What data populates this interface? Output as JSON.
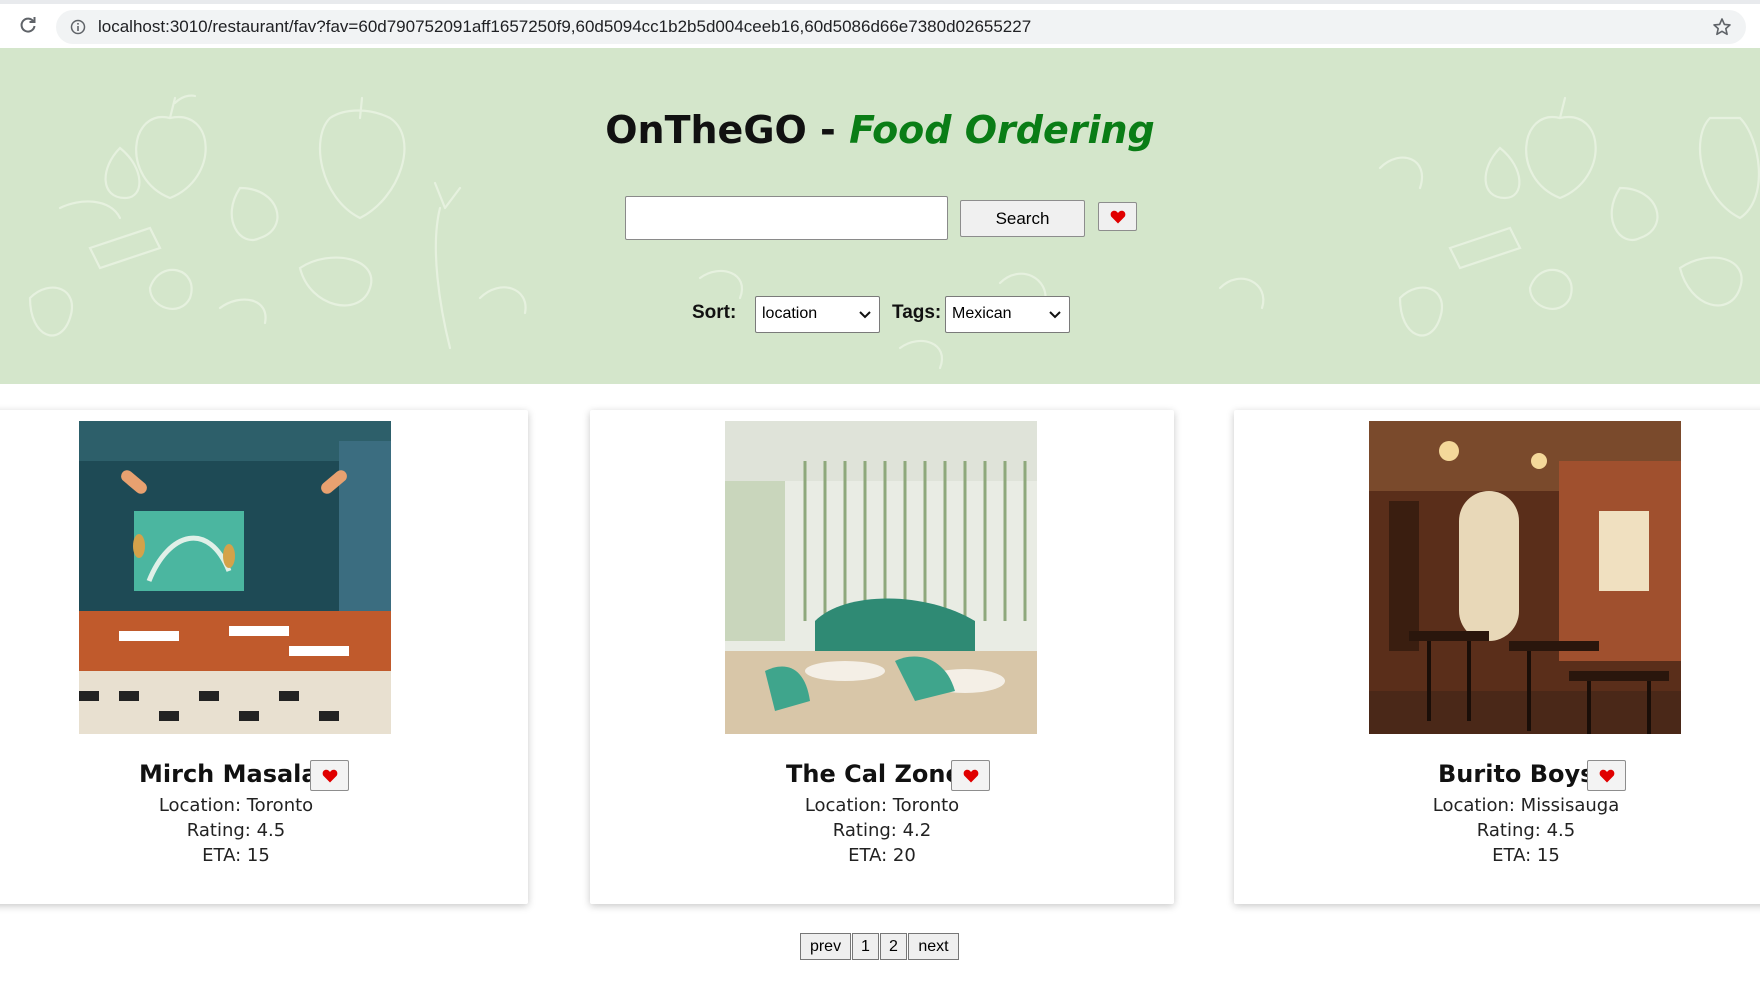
{
  "browser": {
    "url": "localhost:3010/restaurant/fav?fav=60d790752091aff1657250f9,60d5094cc1b2b5d004ceeb16,60d5086d66e7380d02655227"
  },
  "header": {
    "brand": "OnTheGO",
    "separator": " - ",
    "subtitle": "Food Ordering",
    "search_value": "",
    "search_button": "Search",
    "sort_label": "Sort:",
    "sort_value": "location",
    "tags_label": "Tags:",
    "tags_value": "Mexican"
  },
  "restaurants": [
    {
      "name": "Mirch Masala",
      "location": "Location: Toronto",
      "rating": "Rating: 4.5",
      "eta": "ETA: 15"
    },
    {
      "name": "The Cal Zone",
      "location": "Location: Toronto",
      "rating": "Rating: 4.2",
      "eta": "ETA: 20"
    },
    {
      "name": "Burito Boys",
      "location": "Location: Missisauga",
      "rating": "Rating: 4.5",
      "eta": "ETA: 15"
    }
  ],
  "pagination": {
    "prev": "prev",
    "pages": [
      "1",
      "2"
    ],
    "next": "next"
  },
  "colors": {
    "hero_bg": "#d4e6cb",
    "accent_green": "#0a7d16",
    "heart_red": "#e00000"
  },
  "icons": [
    "reload-icon",
    "info-icon",
    "star-icon",
    "heart-icon",
    "chevron-down-icon"
  ]
}
